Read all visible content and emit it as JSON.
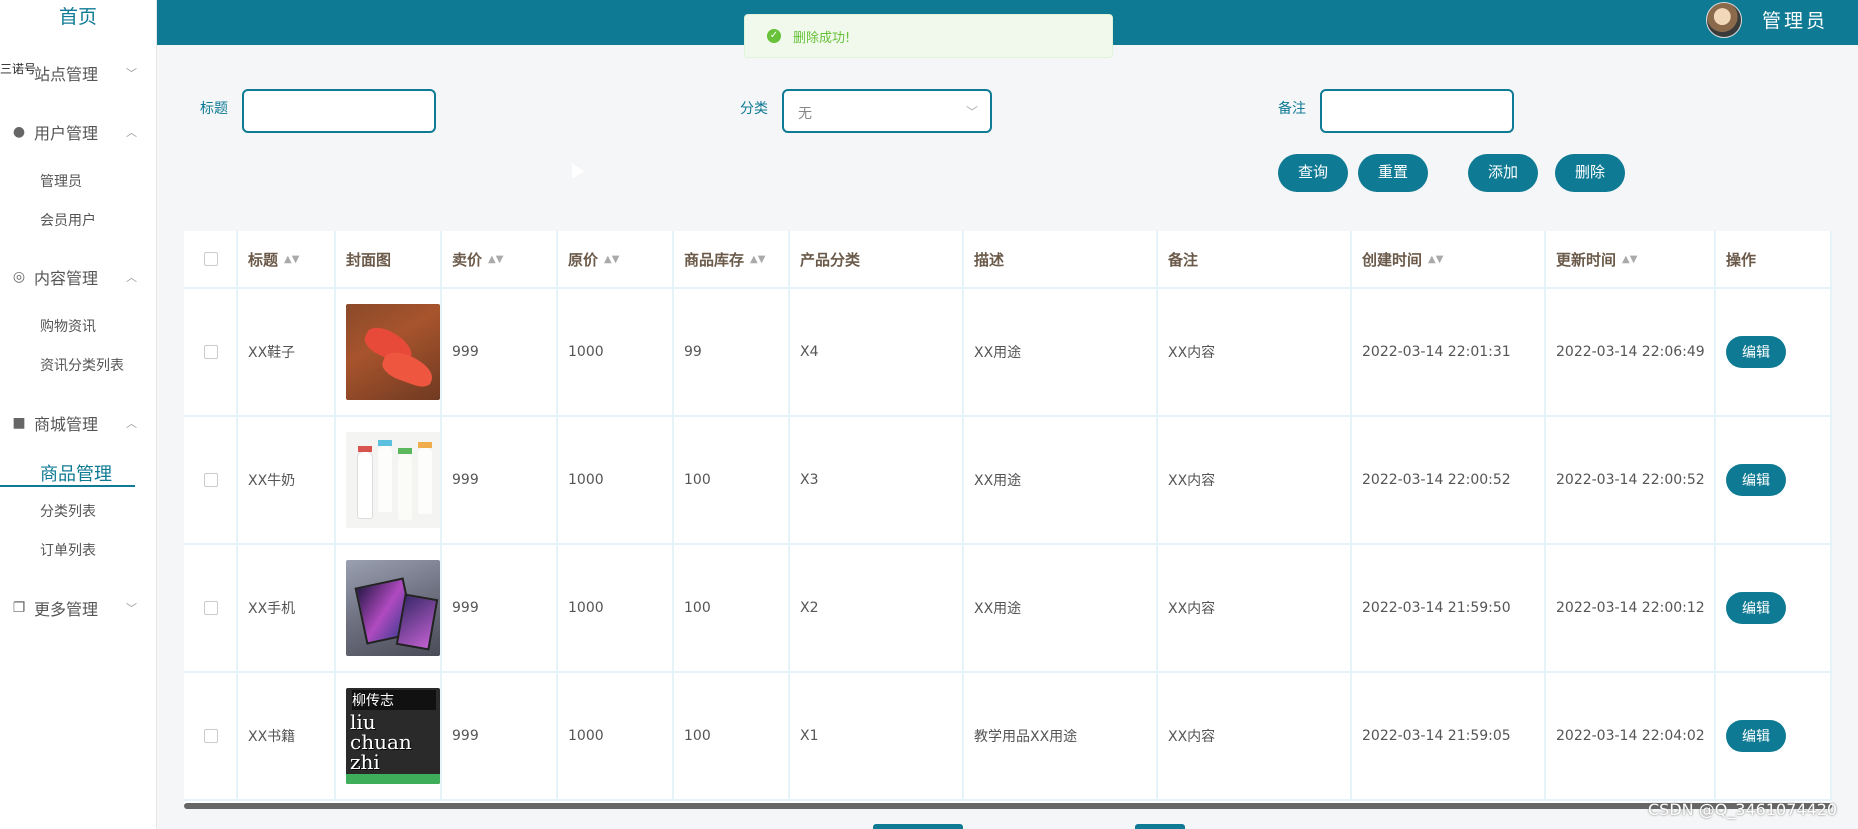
{
  "sidebar": {
    "home": "首页",
    "overlay": "三诺号",
    "groups": [
      {
        "label": "站点管理",
        "icon": "chevron-down-icon"
      },
      {
        "label": "用户管理",
        "icon": "user-icon"
      },
      {
        "label": "内容管理",
        "icon": "chat-icon"
      },
      {
        "label": "商城管理",
        "icon": "bag-icon"
      },
      {
        "label": "更多管理",
        "icon": "copy-icon"
      }
    ],
    "user_items": [
      "管理员",
      "会员用户"
    ],
    "content_items": [
      "购物资讯",
      "资讯分类列表"
    ],
    "shop_items": [
      "商品管理",
      "分类列表",
      "订单列表"
    ]
  },
  "topbar": {
    "admin": "管理员",
    "accent": "#0f7a94"
  },
  "toast": {
    "message": "删除成功!"
  },
  "filters": {
    "title_label": "标题",
    "title_value": "",
    "category_label": "分类",
    "category_value": "无",
    "remark_label": "备注",
    "remark_value": ""
  },
  "actions": {
    "query": "查询",
    "reset": "重置",
    "add": "添加",
    "delete": "删除"
  },
  "table": {
    "headers": [
      "标题",
      "封面图",
      "卖价",
      "原价",
      "商品库存",
      "产品分类",
      "描述",
      "备注",
      "创建时间",
      "更新时间",
      "操作"
    ],
    "rows": [
      {
        "title": "XX鞋子",
        "cover": "shoe",
        "price": "999",
        "orig": "1000",
        "stock": "99",
        "cat": "X4",
        "desc": "XX用途",
        "remark": "XX内容",
        "created": "2022-03-14 22:01:31",
        "updated": "2022-03-14 22:06:49"
      },
      {
        "title": "XX牛奶",
        "cover": "milk",
        "price": "999",
        "orig": "1000",
        "stock": "100",
        "cat": "X3",
        "desc": "XX用途",
        "remark": "XX内容",
        "created": "2022-03-14 22:00:52",
        "updated": "2022-03-14 22:00:52"
      },
      {
        "title": "XX手机",
        "cover": "phone",
        "price": "999",
        "orig": "1000",
        "stock": "100",
        "cat": "X2",
        "desc": "XX用途",
        "remark": "XX内容",
        "created": "2022-03-14 21:59:50",
        "updated": "2022-03-14 22:00:12"
      },
      {
        "title": "XX书籍",
        "cover": "book",
        "price": "999",
        "orig": "1000",
        "stock": "100",
        "cat": "X1",
        "desc": "教学用品XX用途",
        "remark": "XX内容",
        "created": "2022-03-14 21:59:05",
        "updated": "2022-03-14 22:04:02"
      }
    ],
    "edit_label": "编辑"
  },
  "book_cover": {
    "title": "柳传志",
    "letters": "liu chuan zhi"
  },
  "watermark": "CSDN @Q_3461074420"
}
